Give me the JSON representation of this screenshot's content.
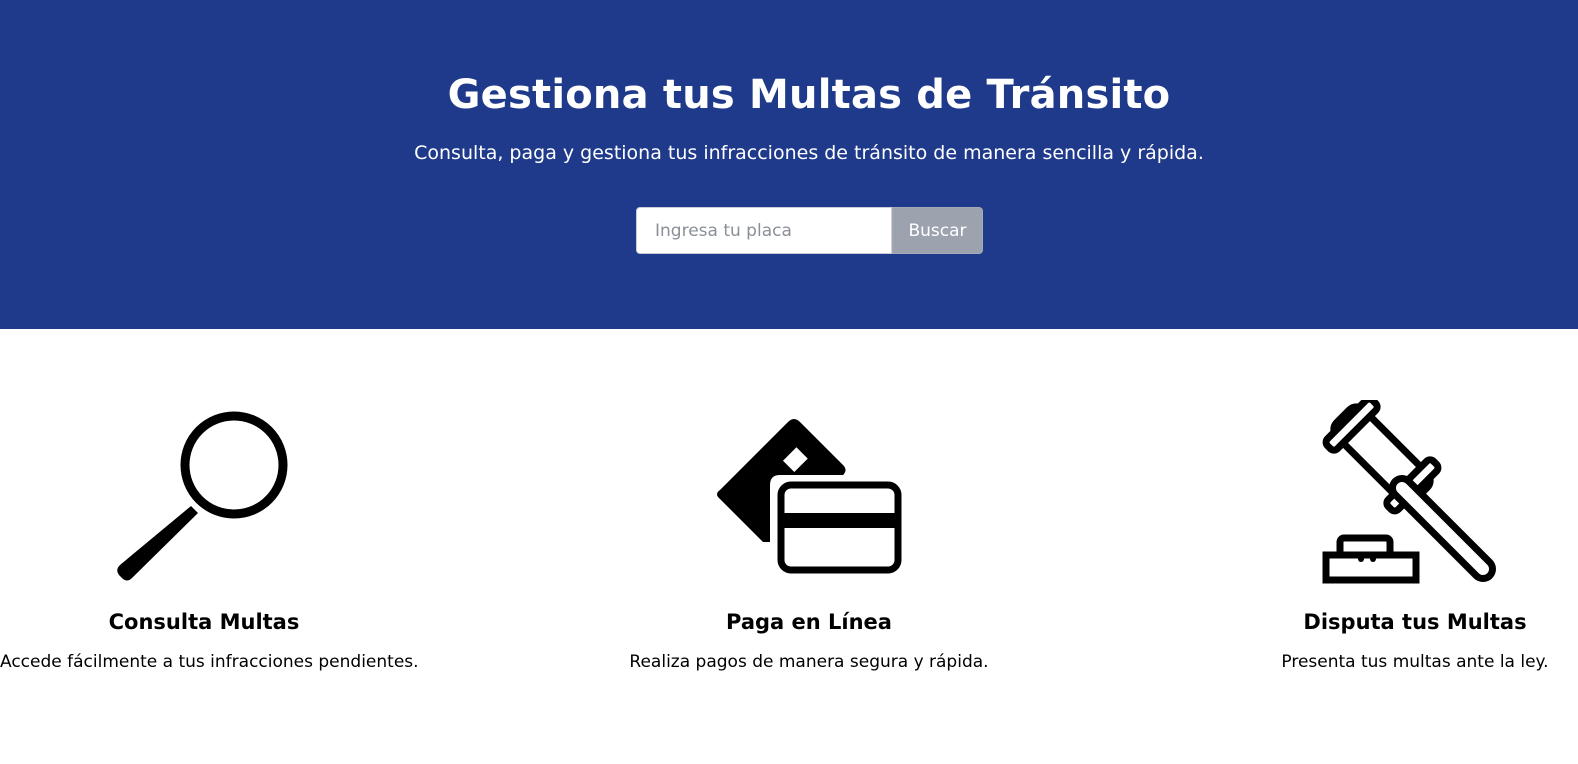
{
  "hero": {
    "title": "Gestiona tus Multas de Tránsito",
    "subtitle": "Consulta, paga y gestiona tus infracciones de tránsito de manera sencilla y rápida.",
    "background_color": "#1f3a8a"
  },
  "search": {
    "placeholder": "Ingresa tu placa",
    "value": "",
    "button_label": "Buscar",
    "button_color": "#9ca3af"
  },
  "features": [
    {
      "icon": "magnifying-glass-icon",
      "title": "Consulta Multas",
      "description": "Accede fácilmente a tus infracciones pendientes."
    },
    {
      "icon": "credit-cards-icon",
      "title": "Paga en Línea",
      "description": "Realiza pagos de manera segura y rápida."
    },
    {
      "icon": "gavel-icon",
      "title": "Disputa tus Multas",
      "description": "Presenta tus multas ante la ley."
    }
  ]
}
